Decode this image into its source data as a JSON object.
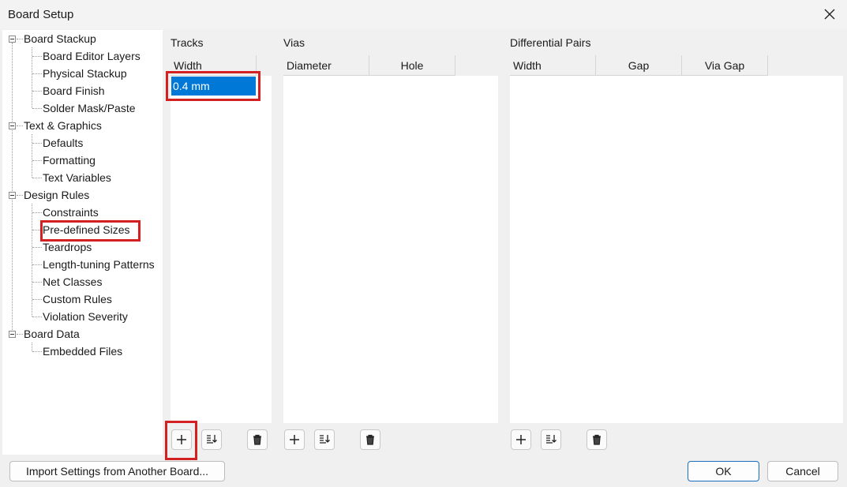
{
  "window": {
    "title": "Board Setup"
  },
  "tree": {
    "groups": [
      {
        "label": "Board Stackup",
        "children": [
          "Board Editor Layers",
          "Physical Stackup",
          "Board Finish",
          "Solder Mask/Paste"
        ]
      },
      {
        "label": "Text & Graphics",
        "children": [
          "Defaults",
          "Formatting",
          "Text Variables"
        ]
      },
      {
        "label": "Design Rules",
        "children": [
          "Constraints",
          "Pre-defined Sizes",
          "Teardrops",
          "Length-tuning Patterns",
          "Net Classes",
          "Custom Rules",
          "Violation Severity"
        ]
      },
      {
        "label": "Board Data",
        "children": [
          "Embedded Files"
        ]
      }
    ],
    "selected": "Pre-defined Sizes"
  },
  "tracks": {
    "title": "Tracks",
    "columns": [
      "Width"
    ],
    "rows": [
      [
        "0.4 mm"
      ]
    ]
  },
  "vias": {
    "title": "Vias",
    "columns": [
      "Diameter",
      "Hole"
    ],
    "rows": []
  },
  "diff_pairs": {
    "title": "Differential Pairs",
    "columns": [
      "Width",
      "Gap",
      "Via Gap"
    ],
    "rows": []
  },
  "toolbar_icons": {
    "add": "plus-icon",
    "sort": "sort-down-icon",
    "delete": "trash-icon"
  },
  "footer": {
    "import_label": "Import Settings from Another Board...",
    "ok_label": "OK",
    "cancel_label": "Cancel"
  },
  "colors": {
    "highlight": "#d32020",
    "selection": "#0078d7"
  }
}
